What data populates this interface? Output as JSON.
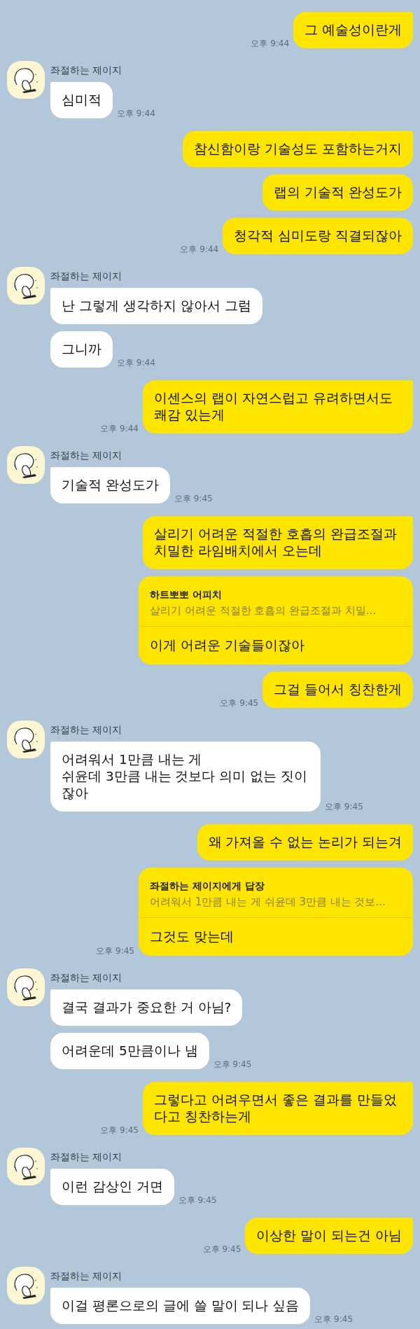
{
  "groups": [
    {
      "kind": "sent",
      "messages": [
        {
          "text": "그 예술성이란게",
          "time": "오후 9:44"
        }
      ]
    },
    {
      "kind": "received",
      "sender": "좌절하는 제이지",
      "messages": [
        {
          "text": "심미적",
          "time": "오후 9:44"
        }
      ]
    },
    {
      "kind": "sent",
      "messages": [
        {
          "text": "참신함이랑 기술성도 포함하는거지"
        },
        {
          "text": "랩의 기술적 완성도가"
        },
        {
          "text": "청각적 심미도랑 직결되잖아",
          "time": "오후 9:44"
        }
      ]
    },
    {
      "kind": "received",
      "sender": "좌절하는 제이지",
      "messages": [
        {
          "text": "난 그렇게 생각하지 않아서 그럼"
        },
        {
          "text": "그니까",
          "time": "오후 9:44"
        }
      ]
    },
    {
      "kind": "sent",
      "messages": [
        {
          "text": "이센스의 랩이 자연스럽고 유려하면서도 쾌감 있는게",
          "time": "오후 9:44"
        }
      ]
    },
    {
      "kind": "received",
      "sender": "좌절하는 제이지",
      "messages": [
        {
          "text": "기술적 완성도가",
          "time": "오후 9:45"
        }
      ]
    },
    {
      "kind": "sent",
      "messages": [
        {
          "text": "살리기 어려운 적절한 호흡의 완급조절과 치밀한 라임배치에서 오는데"
        },
        {
          "text": "이게 어려운 기술들이잖아",
          "reply": {
            "to": "하트뽀뽀 어피치",
            "quote": "살리기 어려운 적절한 호흡의 완급조절과 치밀..."
          }
        },
        {
          "text": "그걸 들어서 칭찬한게",
          "time": "오후 9:45"
        }
      ]
    },
    {
      "kind": "received",
      "sender": "좌절하는 제이지",
      "messages": [
        {
          "text": "어려워서 1만큼 내는 게\n쉬윤데 3만큼 내는 것보다 의미 없는 짓이잖아",
          "time": "오후 9:45"
        }
      ]
    },
    {
      "kind": "sent",
      "messages": [
        {
          "text": "왜 가져올 수 없는 논리가 되는겨"
        },
        {
          "text": "그것도 맞는데",
          "time": "오후 9:45",
          "reply": {
            "to": "좌절하는 제이지에게 답장",
            "quote": "어려워서 1만큼 내는 게 쉬윤데 3만큼 내는 것보..."
          }
        }
      ]
    },
    {
      "kind": "received",
      "sender": "좌절하는 제이지",
      "messages": [
        {
          "text": "결국 결과가 중요한 거 아님?"
        },
        {
          "text": "어려운데 5만큼이나 냄",
          "time": "오후 9:45"
        }
      ]
    },
    {
      "kind": "sent",
      "messages": [
        {
          "text": "그렇다고 어려우면서 좋은 결과를 만들었다고 칭찬하는게",
          "time": "오후 9:45"
        }
      ]
    },
    {
      "kind": "received",
      "sender": "좌절하는 제이지",
      "messages": [
        {
          "text": "이런 감상인 거면",
          "time": "오후 9:45"
        }
      ]
    },
    {
      "kind": "sent",
      "messages": [
        {
          "text": "이상한 말이 되는건 아님",
          "time": "오후 9:45"
        }
      ]
    },
    {
      "kind": "received",
      "sender": "좌절하는 제이지",
      "messages": [
        {
          "text": "이걸 평론으로의 글에 쓸 말이 되나 싶음",
          "time": "오후 9:45"
        }
      ]
    }
  ]
}
